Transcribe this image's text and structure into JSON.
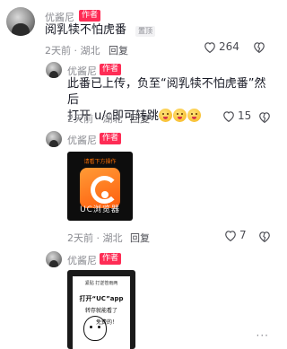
{
  "comment1": {
    "username": "优酱尼",
    "author_tag": "作者",
    "text": "阅乳犊不怕虎番",
    "pin_tag": "置顶",
    "time": "2天前",
    "location": "湖北",
    "reply_label": "回复",
    "like_count": "264"
  },
  "reply1": {
    "username": "优酱尼",
    "author_tag": "作者",
    "text_line1": "此番已上传，负至“阅乳犊不怕虎番”然后",
    "text_line2": "打开 u/c即可转跳",
    "time": "2天前",
    "location": "湖北",
    "reply_label": "回复",
    "like_count": "15"
  },
  "reply2": {
    "username": "优酱尼",
    "author_tag": "作者",
    "image": {
      "banner": "请看下方操作",
      "caption": "UC浏览器"
    },
    "time": "2天前",
    "location": "湖北",
    "reply_label": "回复",
    "like_count": "7"
  },
  "reply3": {
    "username": "优酱尼",
    "author_tag": "作者",
    "image": {
      "top_text": "紧贴 打逆苍雨两",
      "main_text": "打开“UC”app",
      "sub_text1": "转存就能看了",
      "sub_text2": "免费的！"
    }
  },
  "colors": {
    "author_tag_bg": "#fe2c55",
    "meta_text": "#8a8b91",
    "body_text": "#161823"
  }
}
